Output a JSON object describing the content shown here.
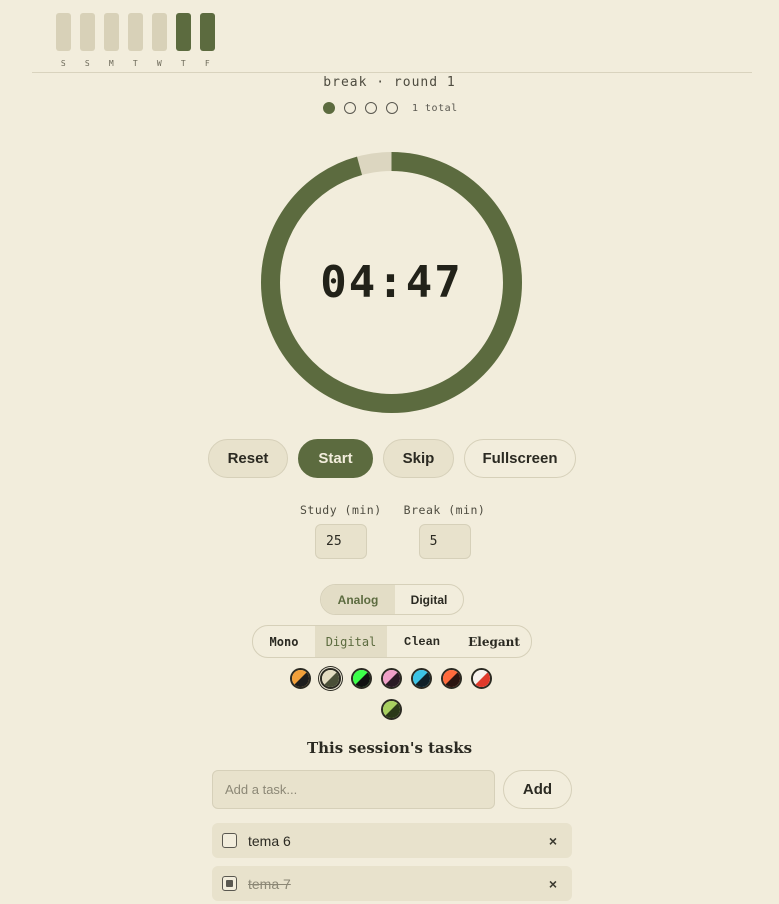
{
  "week": {
    "days": [
      {
        "label": "S",
        "active": false
      },
      {
        "label": "S",
        "active": false
      },
      {
        "label": "M",
        "active": false
      },
      {
        "label": "T",
        "active": false
      },
      {
        "label": "W",
        "active": false
      },
      {
        "label": "T",
        "active": true
      },
      {
        "label": "F",
        "active": true
      }
    ]
  },
  "session": {
    "label": "break · round 1",
    "rounds_completed": 1,
    "rounds_total": 4,
    "total_text": "1 total"
  },
  "timer": {
    "display": "04:47",
    "progress": 0.957,
    "ring_color": "#5c6b3f",
    "track_color": "#dcd6c0"
  },
  "controls": {
    "reset_label": "Reset",
    "start_label": "Start",
    "skip_label": "Skip",
    "fullscreen_label": "Fullscreen"
  },
  "durations": {
    "study_label": "Study (min)",
    "study_value": "25",
    "break_label": "Break (min)",
    "break_value": "5"
  },
  "clock_mode": {
    "options": [
      "Analog",
      "Digital"
    ],
    "selected": "Analog"
  },
  "clock_style": {
    "options": [
      "Mono",
      "Digital",
      "Clean",
      "Elegant"
    ],
    "selected": "Digital"
  },
  "themes": [
    {
      "name": "amber",
      "a": "#f2a03a",
      "b": "#1e1e1e"
    },
    {
      "name": "olive",
      "a": "#e3dcc2",
      "b": "#4a4f38",
      "selected": true
    },
    {
      "name": "neon-green",
      "a": "#3cff4a",
      "b": "#111111"
    },
    {
      "name": "pink",
      "a": "#f0a0c8",
      "b": "#2a1a24"
    },
    {
      "name": "cyan",
      "a": "#3cc4e6",
      "b": "#102028"
    },
    {
      "name": "coral",
      "a": "#ff6a3c",
      "b": "#2a1410"
    },
    {
      "name": "red-white",
      "a": "#f7f2ee",
      "b": "#e03a2c"
    },
    {
      "name": "lime",
      "a": "#a8d060",
      "b": "#2a3818"
    }
  ],
  "tasks": {
    "title": "This session's tasks",
    "input_placeholder": "Add a task...",
    "add_label": "Add",
    "delete_glyph": "×",
    "items": [
      {
        "text": "tema 6",
        "done": false
      },
      {
        "text": "tema 7",
        "done": true
      }
    ]
  }
}
